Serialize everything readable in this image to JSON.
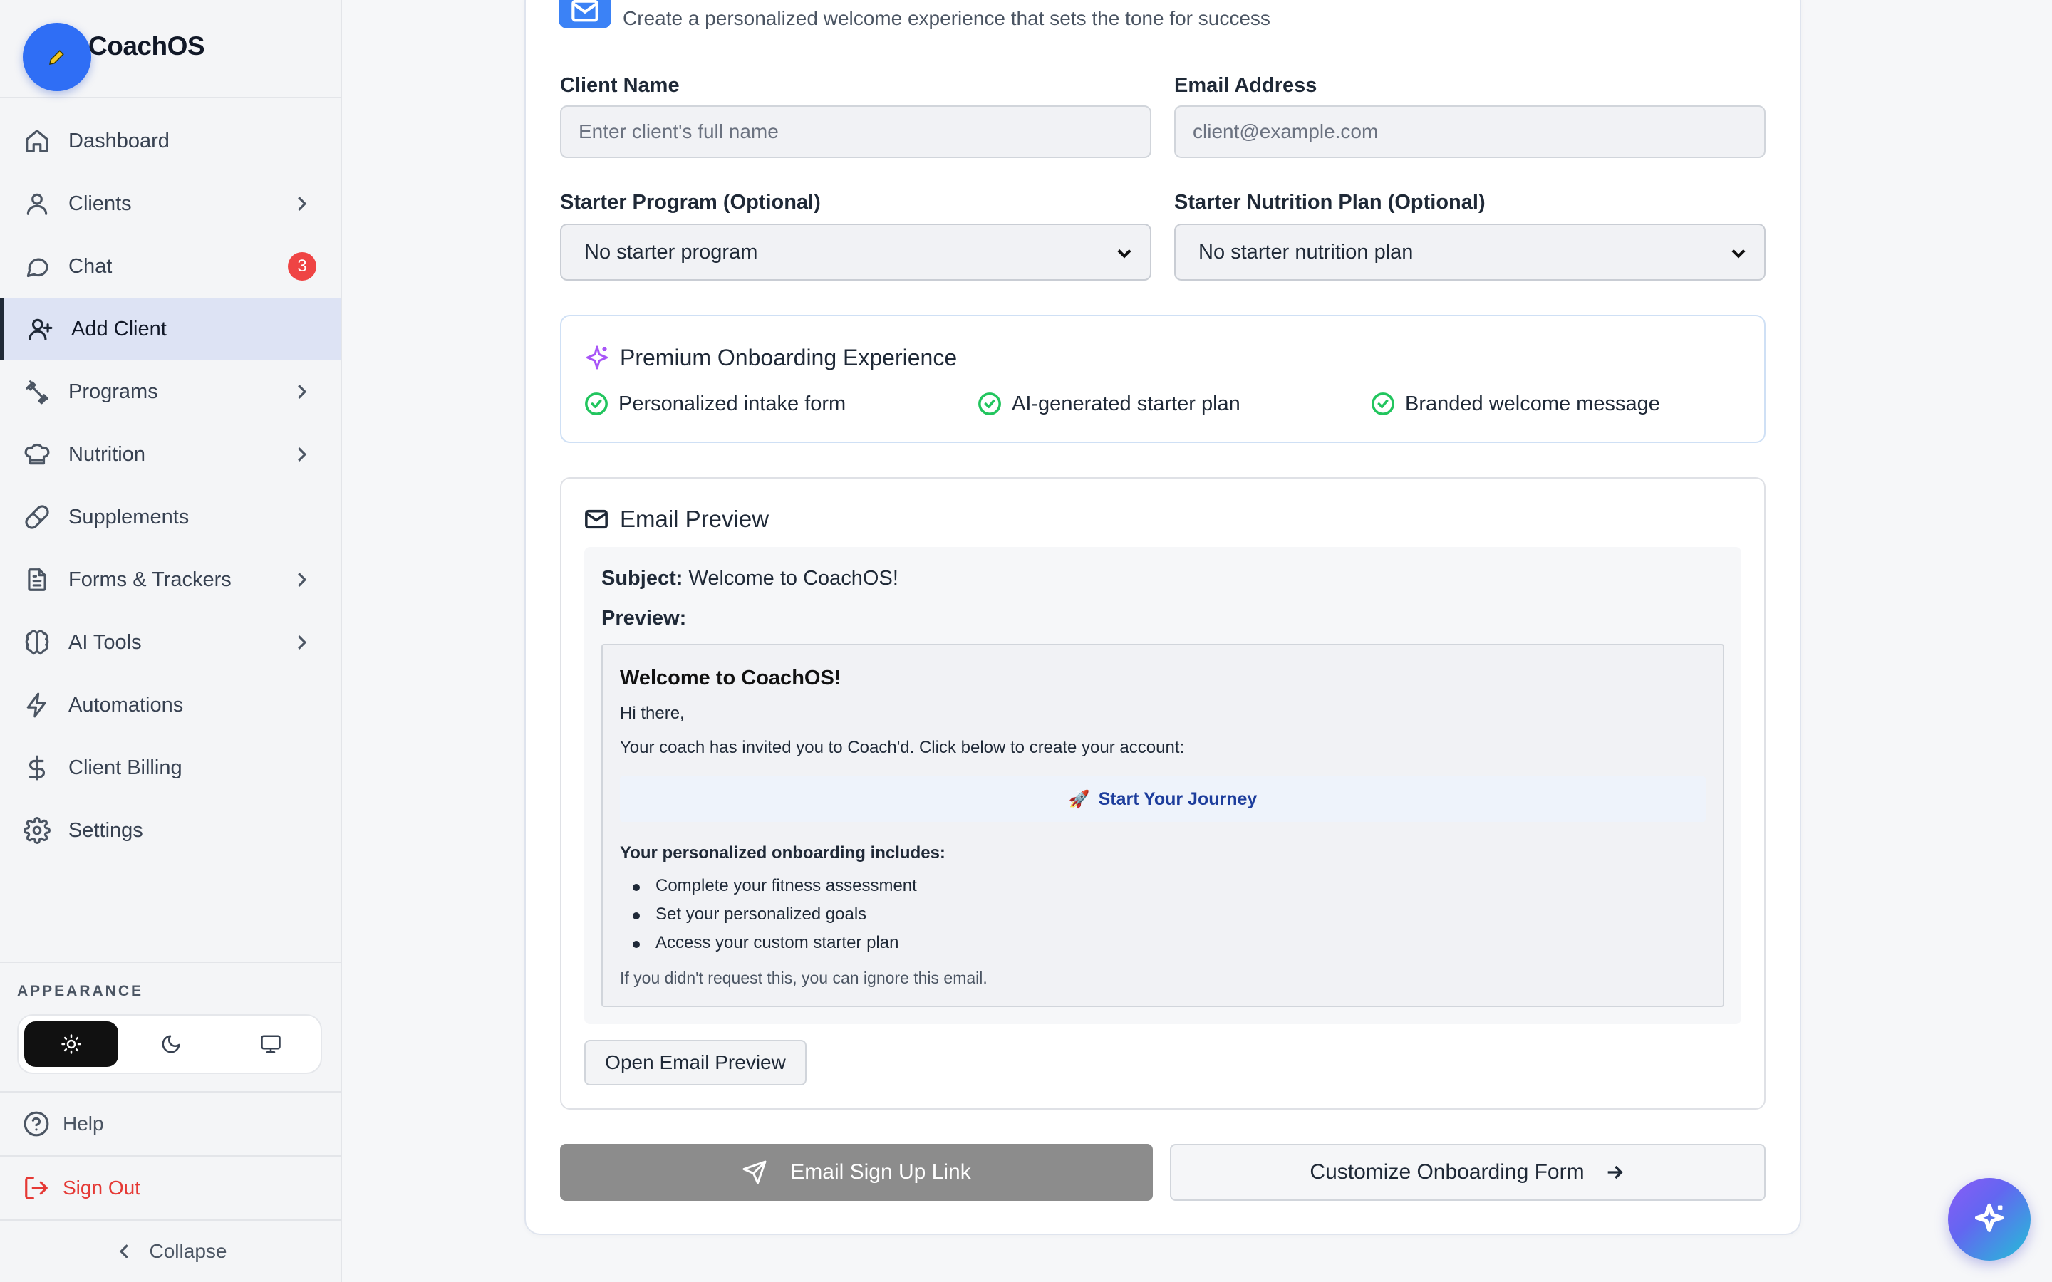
{
  "app": {
    "name": "CoachOS",
    "logo_icon": "pen-icon"
  },
  "sidebar": {
    "items": [
      {
        "label": "Dashboard",
        "icon": "home-icon",
        "has_chevron": false
      },
      {
        "label": "Clients",
        "icon": "user-icon",
        "has_chevron": true
      },
      {
        "label": "Chat",
        "icon": "chat-bubble-icon",
        "has_chevron": false,
        "badge": "3"
      },
      {
        "label": "Add Client",
        "icon": "user-plus-icon",
        "has_chevron": false,
        "active": true
      },
      {
        "label": "Programs",
        "icon": "dumbbell-icon",
        "has_chevron": true
      },
      {
        "label": "Nutrition",
        "icon": "chef-hat-icon",
        "has_chevron": true
      },
      {
        "label": "Supplements",
        "icon": "pill-icon",
        "has_chevron": false
      },
      {
        "label": "Forms & Trackers",
        "icon": "file-text-icon",
        "has_chevron": true
      },
      {
        "label": "AI Tools",
        "icon": "brain-icon",
        "has_chevron": true
      },
      {
        "label": "Automations",
        "icon": "lightning-icon",
        "has_chevron": false
      },
      {
        "label": "Client Billing",
        "icon": "dollar-icon",
        "has_chevron": false
      },
      {
        "label": "Settings",
        "icon": "gear-icon",
        "has_chevron": false
      }
    ],
    "appearance": {
      "label": "APPEARANCE",
      "options": [
        "light",
        "dark",
        "system"
      ],
      "selected": "light"
    },
    "help_label": "Help",
    "signout_label": "Sign Out",
    "collapse_label": "Collapse"
  },
  "header": {
    "subtitle": "Create a personalized welcome experience that sets the tone for success"
  },
  "form": {
    "client_name": {
      "label": "Client Name",
      "placeholder": "Enter client's full name",
      "value": ""
    },
    "email": {
      "label": "Email Address",
      "placeholder": "client@example.com",
      "value": ""
    },
    "starter_program": {
      "label": "Starter Program (Optional)",
      "value": "No starter program"
    },
    "starter_nutrition": {
      "label": "Starter Nutrition Plan (Optional)",
      "value": "No starter nutrition plan"
    }
  },
  "premium": {
    "title": "Premium Onboarding Experience",
    "features": [
      "Personalized intake form",
      "AI-generated starter plan",
      "Branded welcome message"
    ]
  },
  "email_preview": {
    "title": "Email Preview",
    "subject_label": "Subject:",
    "subject": "Welcome to CoachOS!",
    "preview_label": "Preview:",
    "heading": "Welcome to CoachOS!",
    "greeting": "Hi there,",
    "intro": "Your coach has invited you to Coach'd. Click below to create your account:",
    "cta_emoji": "🚀",
    "cta_label": "Start Your Journey",
    "includes_heading": "Your personalized onboarding includes:",
    "includes": [
      "Complete your fitness assessment",
      "Set your personalized goals",
      "Access your custom starter plan"
    ],
    "footer": "If you didn't request this, you can ignore this email.",
    "open_button": "Open Email Preview"
  },
  "actions": {
    "primary": "Email Sign Up Link",
    "secondary": "Customize Onboarding Form"
  },
  "colors": {
    "accent": "#3b82f6",
    "active_nav_bg": "#dde3f4",
    "badge": "#ef4444",
    "signout": "#e53935",
    "success": "#22c55e",
    "sparkle": "#a855f7",
    "primary_button": "#8c8c8c"
  }
}
